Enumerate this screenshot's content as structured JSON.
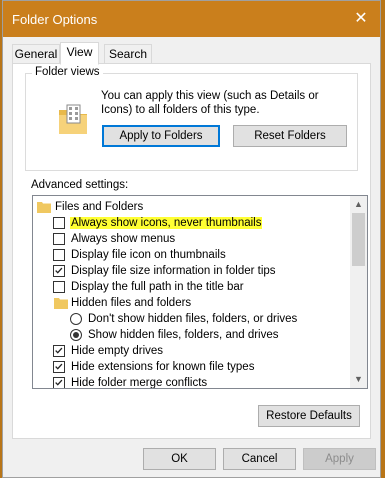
{
  "window": {
    "title": "Folder Options",
    "close_glyph": "✕"
  },
  "tabs": [
    {
      "label": "General"
    },
    {
      "label": "View"
    },
    {
      "label": "Search"
    }
  ],
  "folder_views": {
    "label": "Folder views",
    "text": "You can apply this view (such as Details or Icons) to all folders of this type.",
    "apply_label": "Apply to Folders",
    "reset_label": "Reset Folders"
  },
  "advanced": {
    "label": "Advanced settings:",
    "items": [
      {
        "type": "folder",
        "label": "Files and Folders"
      },
      {
        "type": "checkbox",
        "label": "Always show icons, never thumbnails",
        "checked": false
      },
      {
        "type": "checkbox",
        "label": "Always show menus",
        "checked": false
      },
      {
        "type": "checkbox",
        "label": "Display file icon on thumbnails",
        "checked": false
      },
      {
        "type": "checkbox",
        "label": "Display file size information in folder tips",
        "checked": true
      },
      {
        "type": "checkbox",
        "label": "Display the full path in the title bar",
        "checked": false
      },
      {
        "type": "folder",
        "label": "Hidden files and folders"
      },
      {
        "type": "radio",
        "label": "Don't show hidden files, folders, or drives",
        "checked": false
      },
      {
        "type": "radio",
        "label": "Show hidden files, folders, and drives",
        "checked": true
      },
      {
        "type": "checkbox",
        "label": "Hide empty drives",
        "checked": true
      },
      {
        "type": "checkbox",
        "label": "Hide extensions for known file types",
        "checked": true
      },
      {
        "type": "checkbox",
        "label": "Hide folder merge conflicts",
        "checked": true
      }
    ]
  },
  "buttons": {
    "restore_defaults": "Restore Defaults",
    "ok": "OK",
    "cancel": "Cancel",
    "apply": "Apply"
  },
  "colors": {
    "titlebar": "#ca7f1c",
    "highlight": "#ffff33",
    "accent": "#0078d7"
  }
}
